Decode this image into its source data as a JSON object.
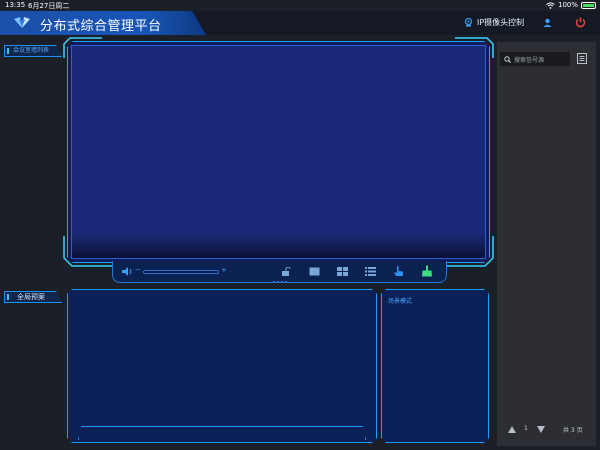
{
  "status": {
    "time": "13:35",
    "date": "6月27日周二",
    "battery": "100%"
  },
  "header": {
    "title": "分布式综合管理平台",
    "camera_control_label": "IP摄像头控制",
    "icons": [
      "logo-icon",
      "camera-icon",
      "user-icon",
      "power-icon"
    ]
  },
  "sidebar": {
    "meeting_list_label": "会议室墙列表",
    "global_preview_label": "全局预案"
  },
  "toolbar": {
    "volume_minus": "−",
    "volume_plus": "+",
    "volume_level": 0,
    "icons": [
      "volume-icon",
      "unlock-icon",
      "single-screen-icon",
      "quad-screen-icon",
      "list-icon",
      "touch-icon",
      "clear-icon"
    ]
  },
  "scene": {
    "mode_label": "场景模式"
  },
  "right_panel": {
    "search_placeholder": "搜索信号源",
    "pager": {
      "current": "1",
      "total_label": "共 3 页"
    }
  },
  "colors": {
    "accent": "#1aa3ff",
    "title_blue": "#1756b8",
    "power_red": "#ff4040",
    "green_icon": "#3ddc84"
  }
}
